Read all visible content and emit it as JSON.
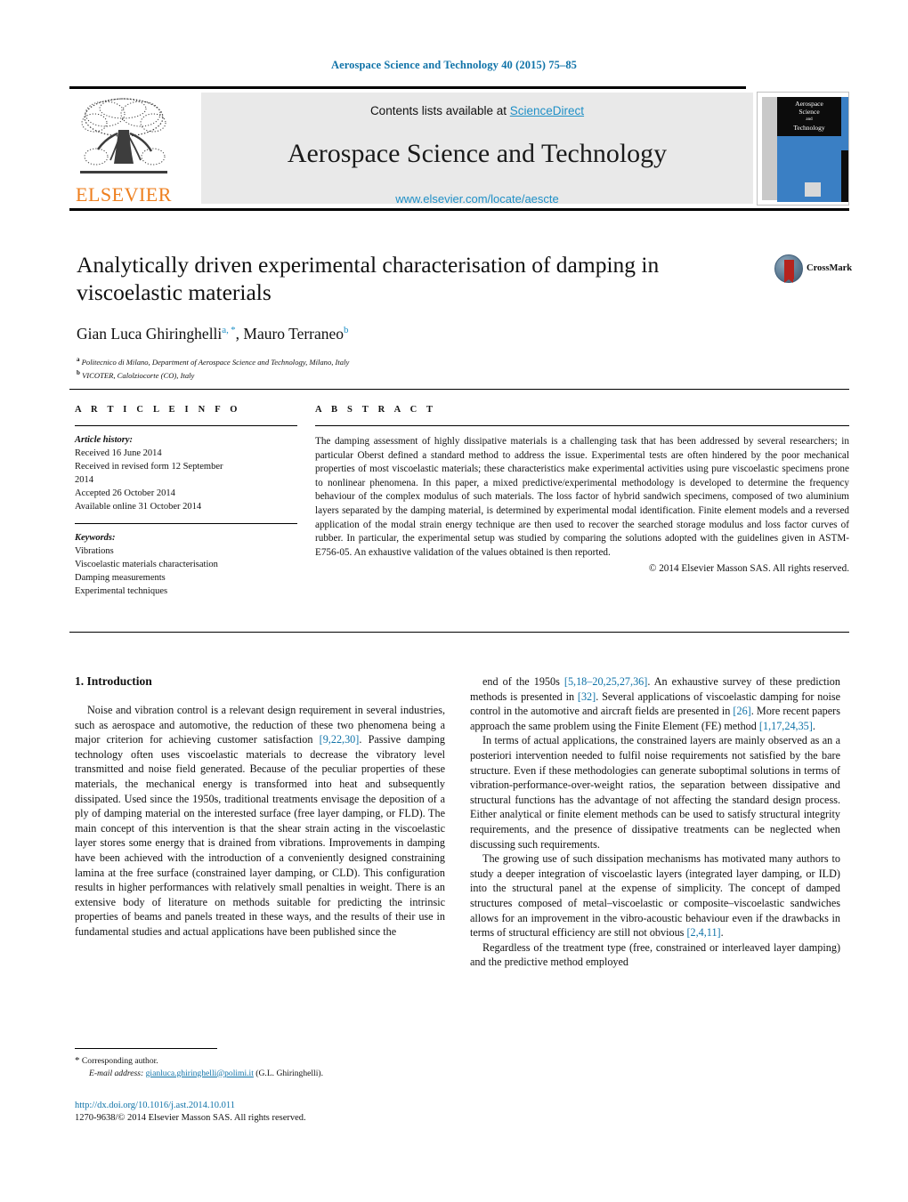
{
  "running_head": "Aerospace Science and Technology 40 (2015) 75–85",
  "masthead": {
    "contents_prefix": "Contents lists available at ",
    "sciencedirect": "ScienceDirect",
    "journal_title": "Aerospace Science and Technology",
    "journal_url": "www.elsevier.com/locate/aescte",
    "publisher": "ELSEVIER",
    "cover_title_line1": "Aerospace",
    "cover_title_line2": "Science",
    "cover_title_line3": "and",
    "cover_title_line4": "Technology"
  },
  "crossmark": {
    "label": "CrossMark"
  },
  "article": {
    "title": "Analytically driven experimental characterisation of damping in viscoelastic materials",
    "authors_html": "Gian Luca Ghiringhelli<sup>a, *</sup>, Mauro Terraneo<sup>b</sup>",
    "affiliations": [
      {
        "marker": "a",
        "text": "Politecnico di Milano, Department of Aerospace Science and Technology, Milano, Italy"
      },
      {
        "marker": "b",
        "text": "VICOTER, Calolziocorte (CO), Italy"
      }
    ]
  },
  "info": {
    "kicker": "A R T I C L E    I N F O",
    "history_label": "Article history:",
    "history": [
      "Received 16 June 2014",
      "Received in revised form 12 September",
      "2014",
      "Accepted 26 October 2014",
      "Available online 31 October 2014"
    ],
    "keywords_label": "Keywords:",
    "keywords": [
      "Vibrations",
      "Viscoelastic materials characterisation",
      "Damping measurements",
      "Experimental techniques"
    ]
  },
  "abstract": {
    "kicker": "A B S T R A C T",
    "text": "The damping assessment of highly dissipative materials is a challenging task that has been addressed by several researchers; in particular Oberst defined a standard method to address the issue. Experimental tests are often hindered by the poor mechanical properties of most viscoelastic materials; these characteristics make experimental activities using pure viscoelastic specimens prone to nonlinear phenomena. In this paper, a mixed predictive/experimental methodology is developed to determine the frequency behaviour of the complex modulus of such materials. The loss factor of hybrid sandwich specimens, composed of two aluminium layers separated by the damping material, is determined by experimental modal identification. Finite element models and a reversed application of the modal strain energy technique are then used to recover the searched storage modulus and loss factor curves of rubber. In particular, the experimental setup was studied by comparing the solutions adopted with the guidelines given in ASTM-E756-05. An exhaustive validation of the values obtained is then reported.",
    "copyright": "© 2014 Elsevier Masson SAS. All rights reserved."
  },
  "body": {
    "section_title": "1. Introduction",
    "left_paragraphs": [
      "Noise and vibration control is a relevant design requirement in several industries, such as aerospace and automotive, the reduction of these two phenomena being a major criterion for achieving customer satisfaction [9,22,30]. Passive damping technology often uses viscoelastic materials to decrease the vibratory level transmitted and noise field generated. Because of the peculiar properties of these materials, the mechanical energy is transformed into heat and subsequently dissipated. Used since the 1950s, traditional treatments envisage the deposition of a ply of damping material on the interested surface (free layer damping, or FLD). The main concept of this intervention is that the shear strain acting in the viscoelastic layer stores some energy that is drained from vibrations. Improvements in damping have been achieved with the introduction of a conveniently designed constraining lamina at the free surface (constrained layer damping, or CLD). This configuration results in higher performances with relatively small penalties in weight. There is an extensive body of literature on methods suitable for predicting the intrinsic properties of beams and panels treated in these ways, and the results of their use in fundamental studies and actual applications have been published since the"
    ],
    "right_paragraphs": [
      "end of the 1950s [5,18–20,25,27,36]. An exhaustive survey of these prediction methods is presented in [32]. Several applications of viscoelastic damping for noise control in the automotive and aircraft fields are presented in [26]. More recent papers approach the same problem using the Finite Element (FE) method [1,17,24,35].",
      "In terms of actual applications, the constrained layers are mainly observed as an a posteriori intervention needed to fulfil noise requirements not satisfied by the bare structure. Even if these methodologies can generate suboptimal solutions in terms of vibration-performance-over-weight ratios, the separation between dissipative and structural functions has the advantage of not affecting the standard design process. Either analytical or finite element methods can be used to satisfy structural integrity requirements, and the presence of dissipative treatments can be neglected when discussing such requirements.",
      "The growing use of such dissipation mechanisms has motivated many authors to study a deeper integration of viscoelastic layers (integrated layer damping, or ILD) into the structural panel at the expense of simplicity. The concept of damped structures composed of metal–viscoelastic or composite–viscoelastic sandwiches allows for an improvement in the vibro-acoustic behaviour even if the drawbacks in terms of structural efficiency are still not obvious [2,4,11].",
      "Regardless of the treatment type (free, constrained or interleaved layer damping) and the predictive method employed"
    ]
  },
  "footnote": {
    "star": "*",
    "corresponding": "Corresponding author.",
    "email_label": "E-mail address:",
    "email": "gianluca.ghiringhelli@polimi.it",
    "email_attrib": "(G.L. Ghiringhelli)."
  },
  "imprint": {
    "doi": "http://dx.doi.org/10.1016/j.ast.2014.10.011",
    "issn": "1270-9638/© 2014 Elsevier Masson SAS. All rights reserved."
  },
  "colors": {
    "link_blue": "#1073a8",
    "sciencedirect_blue": "#1E8FC6",
    "elsevier_orange": "#EE7F1E",
    "cover_blue": "#3a7fc4"
  }
}
